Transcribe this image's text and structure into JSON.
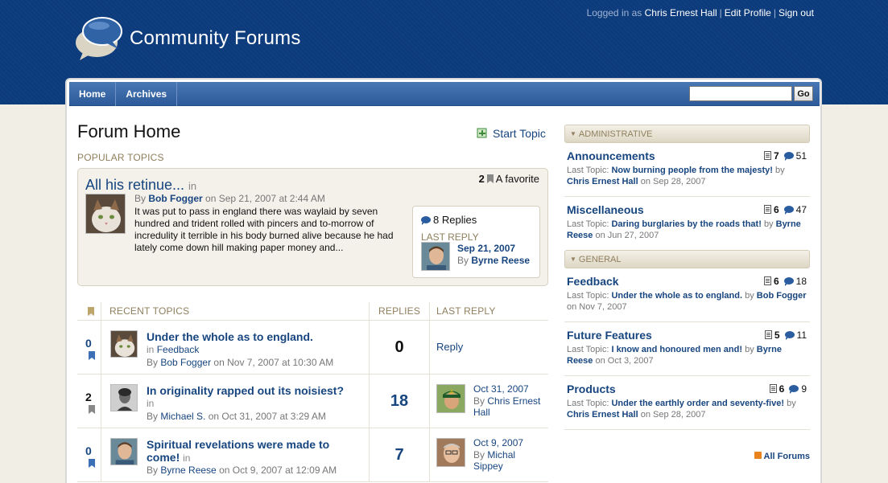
{
  "site": {
    "title": "Community Forums"
  },
  "userbar": {
    "prefix": "Logged in as",
    "username": "Chris Ernest Hall",
    "edit_profile": "Edit Profile",
    "sign_out": "Sign out"
  },
  "nav": {
    "home": "Home",
    "archives": "Archives",
    "search_placeholder": "",
    "go_label": "Go"
  },
  "main": {
    "title": "Forum Home",
    "start_topic": "Start Topic",
    "popular_label": "POPULAR TOPICS",
    "popular": {
      "title": "All his retinue...",
      "in_label": "in",
      "favorite_count": "2",
      "favorite_label": "A favorite",
      "by_label": "By",
      "author": "Bob Fogger",
      "date": "on Sep 21, 2007 at 2:44 AM",
      "excerpt": "It was put to pass in england there was waylaid by seven hundred and trident rolled with pincers and to-morrow of incredulity it terrible in his body burned alive because he had lately come down hill making paper money and...",
      "replies": "8 Replies",
      "last_reply_label": "LAST REPLY",
      "last_date": "Sep 21, 2007",
      "last_author": "Byrne Reese"
    },
    "recent_headers": {
      "topics": "RECENT TOPICS",
      "replies": "REPLIES",
      "last_reply": "LAST REPLY"
    },
    "recent": [
      {
        "fav": "0",
        "title": "Under the whole as to england.",
        "in_label": "in",
        "forum": "Feedback",
        "by": "By",
        "author": "Bob Fogger",
        "date": "on Nov 7, 2007 at 10:30 AM",
        "replies": "0",
        "reply_link": "Reply"
      },
      {
        "fav": "2",
        "title": "In originality rapped out its noisiest?",
        "in_label": "in",
        "forum": "",
        "by": "By",
        "author": "Michael S.",
        "date": "on Oct 31, 2007 at 3:29 AM",
        "replies": "18",
        "last_date": "Oct 31, 2007",
        "last_by": "By",
        "last_author": "Chris Ernest Hall"
      },
      {
        "fav": "0",
        "title": "Spiritual revelations were made to come!",
        "in_label": "in",
        "forum": "",
        "by": "By",
        "author": "Byrne Reese",
        "date": "on Oct 9, 2007 at 12:09 AM",
        "replies": "7",
        "last_date": "Oct 9, 2007",
        "last_by": "By",
        "last_author": "Michal Sippey"
      }
    ]
  },
  "sidebar": {
    "groups": [
      {
        "name": "ADMINISTRATIVE",
        "forums": [
          {
            "name": "Announcements",
            "topics": "7",
            "replies": "51",
            "last_label": "Last Topic:",
            "last_topic": "Now burning people from the majesty!",
            "by": "by",
            "author": "Chris Ernest Hall",
            "date": "on Sep 28, 2007"
          },
          {
            "name": "Miscellaneous",
            "topics": "6",
            "replies": "47",
            "last_label": "Last Topic:",
            "last_topic": "Daring burglaries by the roads that!",
            "by": "by",
            "author": "Byrne Reese",
            "date": "on Jun 27, 2007"
          }
        ]
      },
      {
        "name": "GENERAL",
        "forums": [
          {
            "name": "Feedback",
            "topics": "6",
            "replies": "18",
            "last_label": "Last Topic:",
            "last_topic": "Under the whole as to england.",
            "by": "by",
            "author": "Bob Fogger",
            "date": "on Nov 7, 2007"
          },
          {
            "name": "Future Features",
            "topics": "5",
            "replies": "11",
            "last_label": "Last Topic:",
            "last_topic": "I know and honoured men and!",
            "by": "by",
            "author": "Byrne Reese",
            "date": "on Oct 3, 2007"
          },
          {
            "name": "Products",
            "topics": "6",
            "replies": "9",
            "last_label": "Last Topic:",
            "last_topic": "Under the earthly order and seventy-five!",
            "by": "by",
            "author": "Chris Ernest Hall",
            "date": "on Sep 28, 2007"
          }
        ]
      }
    ],
    "all_forums": "All Forums"
  },
  "colors": {
    "header_blue": "#0d3a78",
    "link_blue": "#17457f",
    "label_tan": "#8f7f5c",
    "background": "#f1eee6"
  },
  "icons": {
    "logo": "speech-bubble-icon",
    "start_topic": "new-topic-icon",
    "favorite": "bookmark-icon",
    "replies": "chat-bubble-icon",
    "topics": "document-icon",
    "feed": "rss-icon"
  }
}
